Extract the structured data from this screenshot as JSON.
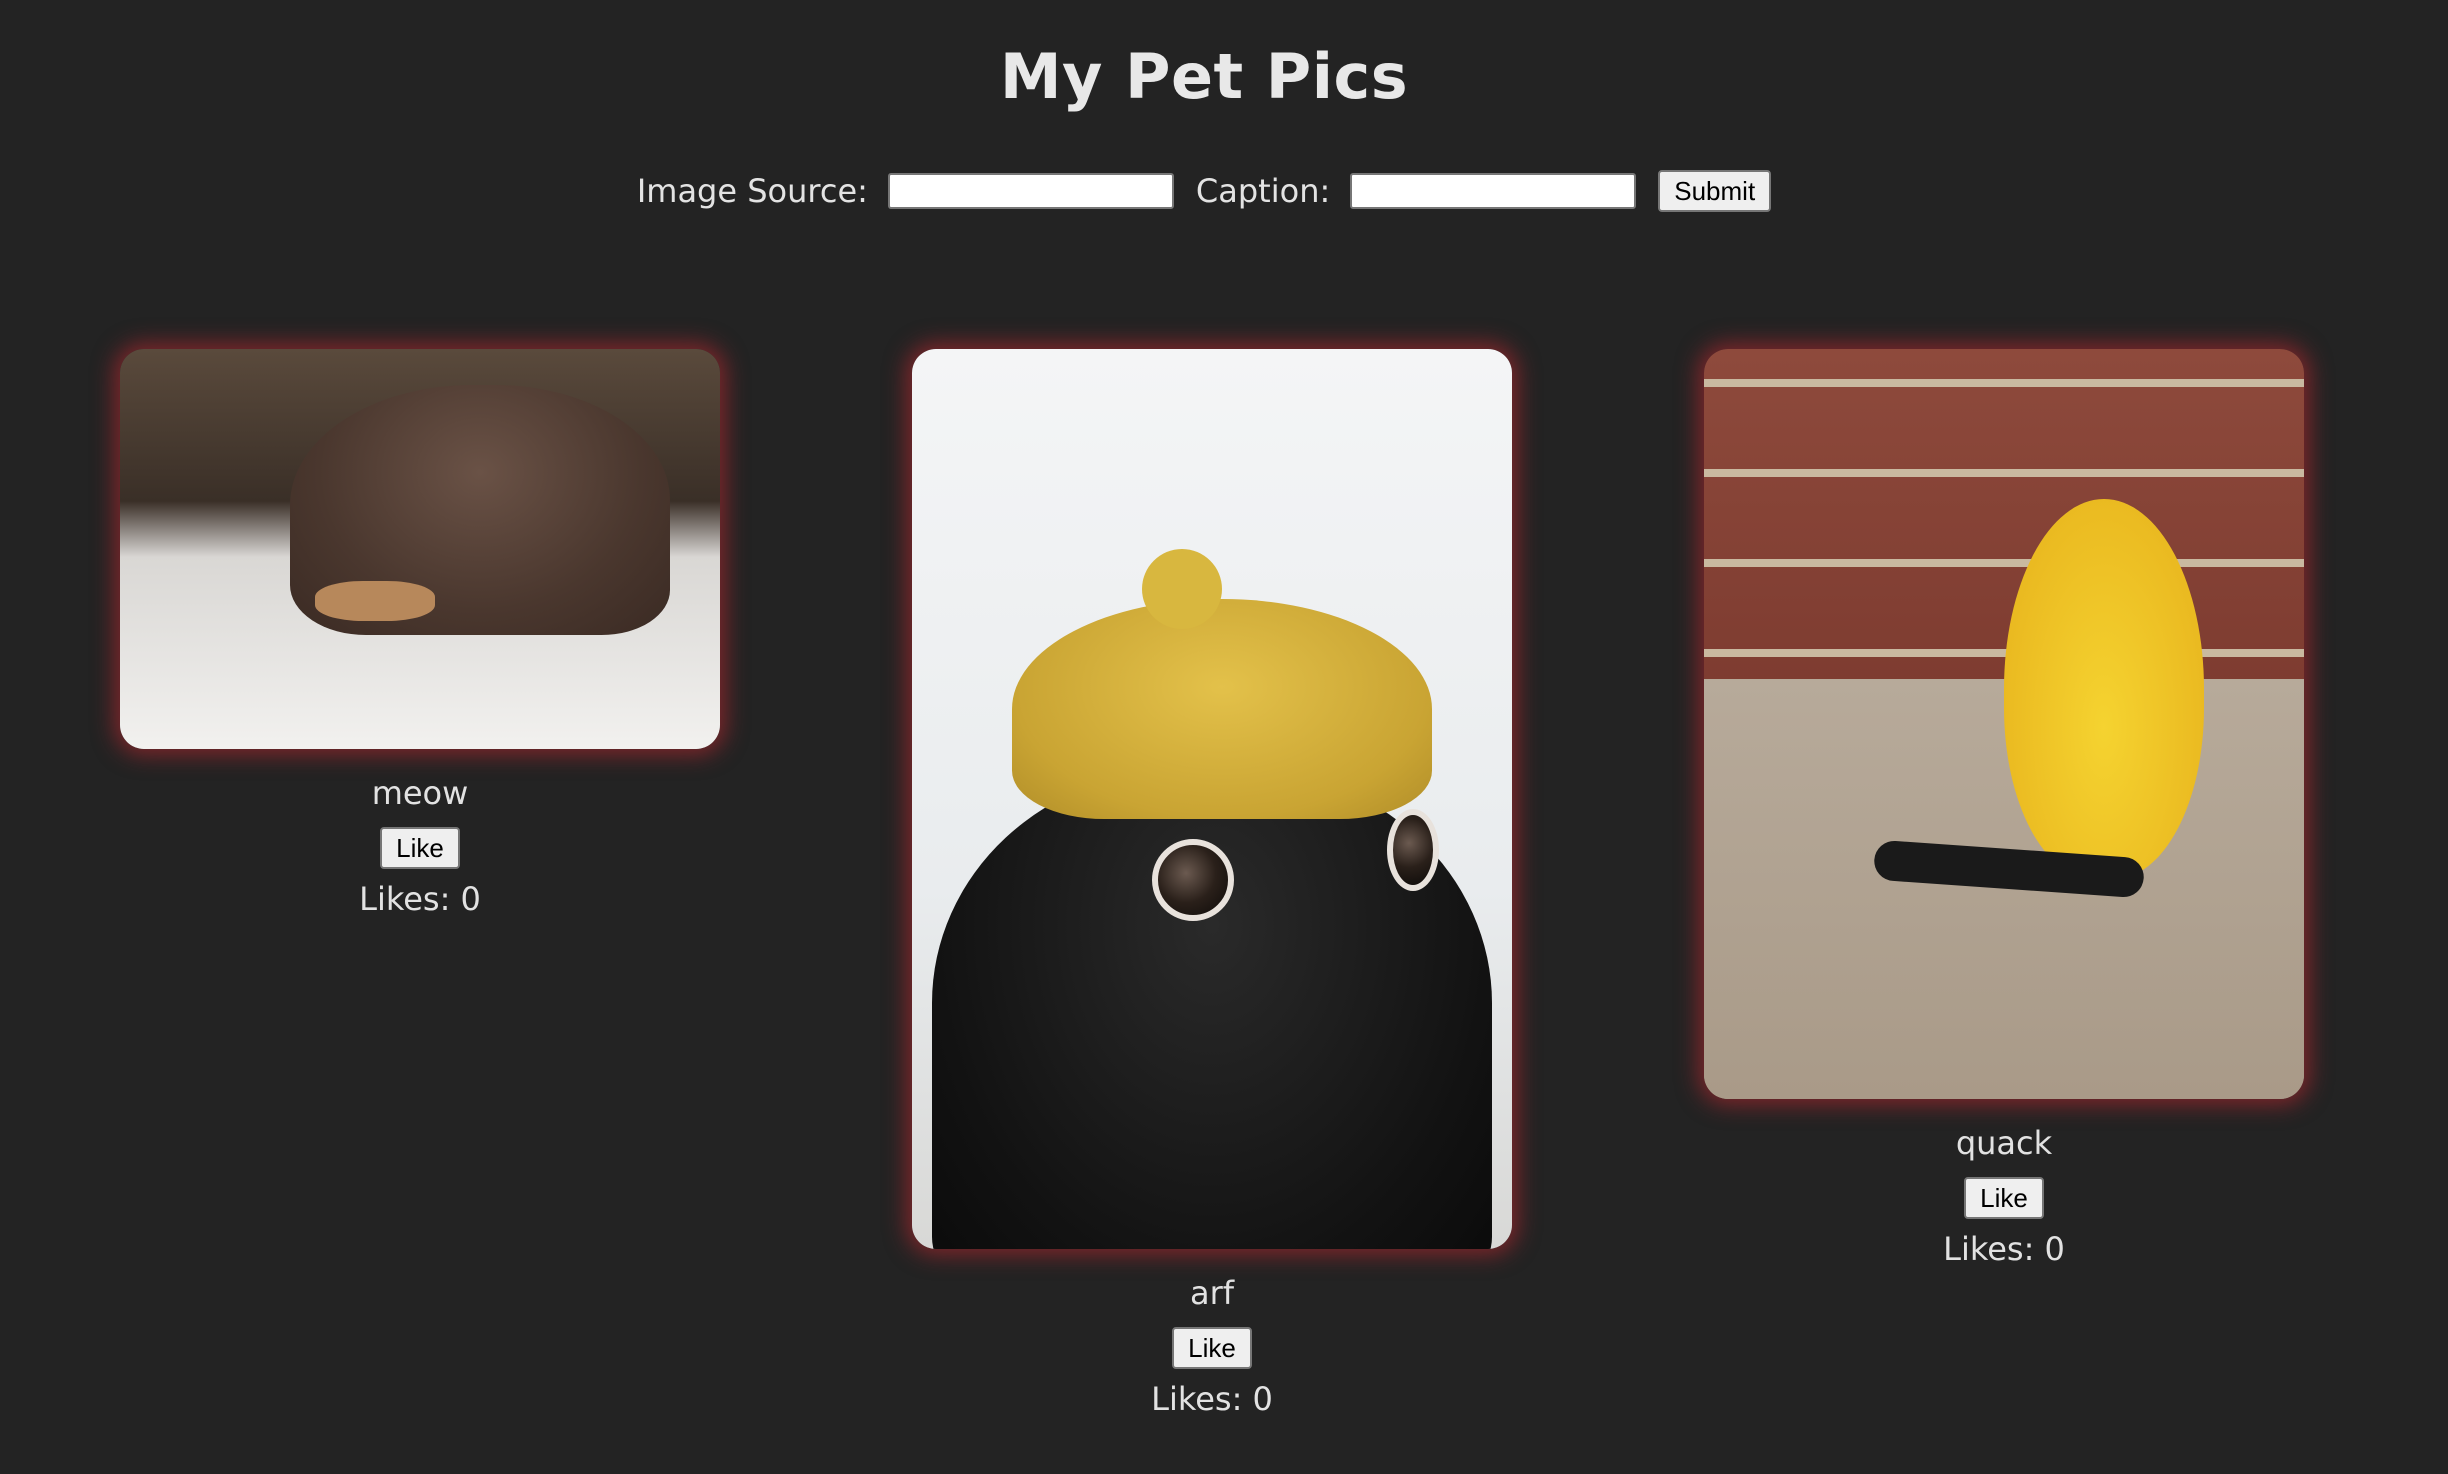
{
  "page": {
    "title": "My Pet Pics"
  },
  "form": {
    "image_source_label": "Image Source:",
    "image_source_value": "",
    "caption_label": "Caption:",
    "caption_value": "",
    "submit_label": "Submit"
  },
  "posts": [
    {
      "caption": "meow",
      "like_label": "Like",
      "likes_text": "Likes: 0"
    },
    {
      "caption": "arf",
      "like_label": "Like",
      "likes_text": "Likes: 0"
    },
    {
      "caption": "quack",
      "like_label": "Like",
      "likes_text": "Likes: 0"
    }
  ],
  "colors": {
    "background": "#232323",
    "text": "#e6e6e6",
    "glow": "#c82832"
  }
}
